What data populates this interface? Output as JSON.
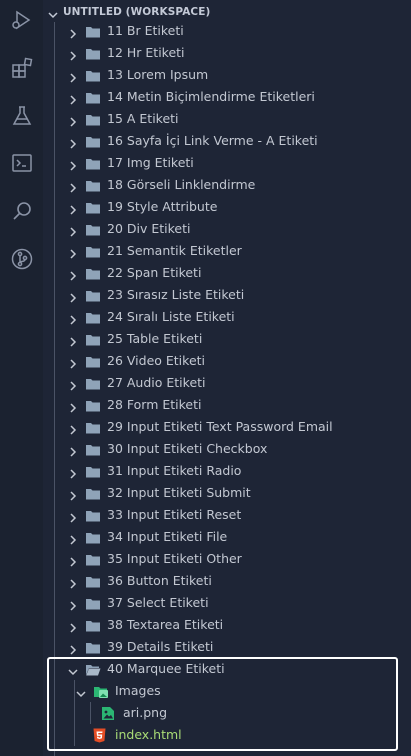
{
  "workspace": {
    "title": "UNTITLED (WORKSPACE)"
  },
  "activity_bar": {
    "items": [
      {
        "icon": "run-debug-icon"
      },
      {
        "icon": "extensions-icon"
      },
      {
        "icon": "testing-flask-icon"
      },
      {
        "icon": "terminal-icon"
      },
      {
        "icon": "search-icon"
      },
      {
        "icon": "source-control-icon"
      }
    ]
  },
  "folders": [
    "11 Br Etiketi",
    "12 Hr Etiketi",
    "13 Lorem Ipsum",
    "14 Metin Biçimlendirme Etiketleri",
    "15 A Etiketi",
    "16 Sayfa İçi Link Verme - A Etiketi",
    "17 Img Etiketi",
    "18 Görseli Linklendirme",
    "19 Style Attribute",
    "20 Div Etiketi",
    "21 Semantik Etiketler",
    "22 Span Etiketi",
    "23 Sırasız Liste Etiketi",
    "24 Sıralı Liste Etiketi",
    "25 Table Etiketi",
    "26 Video Etiketi",
    "27 Audio Etiketi",
    "28 Form Etiketi",
    "29 Input Etiketi Text Password Email",
    "30 Input Etiketi Checkbox",
    "31 Input Etiketi Radio",
    "32 Input Etiketi Submit",
    "33 Input Etiketi Reset",
    "34 Input Etiketi File",
    "35 Input Etiketi Other",
    "36 Button Etiketi",
    "37 Select Etiketi",
    "38 Textarea Etiketi",
    "39 Details Etiketi"
  ],
  "expanded": {
    "folder": "40 Marquee Etiketi",
    "subfolder": "Images",
    "image_file": "ari.png",
    "html_file": "index.html"
  },
  "colors": {
    "background": "#1e2536",
    "text": "#c3c8d2",
    "folder_icon": "#8fa3b8",
    "images_folder_icon": "#2bb673",
    "html_icon": "#e44d26",
    "highlight_border": "#ffffff",
    "html_file_text": "#a9dc76"
  }
}
